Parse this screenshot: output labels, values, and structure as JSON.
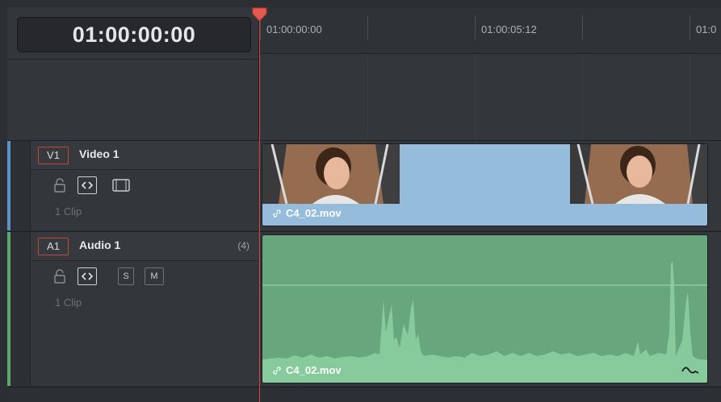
{
  "timecode": "01:00:00:00",
  "ruler": {
    "labels": [
      "01:00:00:00",
      "01:00:05:12",
      "01:0"
    ]
  },
  "tracks": {
    "video": {
      "id": "V1",
      "name": "Video 1",
      "clip_count": "1 Clip",
      "clip_name": "C4_02.mov",
      "color": "#96bcdc",
      "side_color": "#5c93c4"
    },
    "audio": {
      "id": "A1",
      "name": "Audio 1",
      "channels": "(4)",
      "clip_count": "1 Clip",
      "clip_name": "C4_02.mov",
      "solo_label": "S",
      "mute_label": "M",
      "color": "#68a67d",
      "side_color": "#5aa86e"
    }
  },
  "icons": {
    "lock": "lock-icon",
    "auto_select": "auto-select-icon",
    "video_toggle": "film-icon",
    "link": "link-icon",
    "curve": "audio-curve-icon"
  },
  "playhead_color": "#d6453d"
}
